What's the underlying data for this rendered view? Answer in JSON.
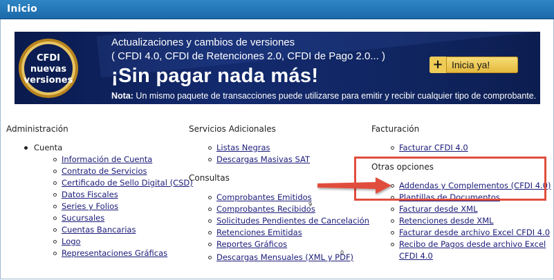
{
  "header": {
    "title": "Inicio"
  },
  "banner": {
    "badge_line1": "CFDI",
    "badge_line2": "nuevas",
    "badge_line3": "versiones",
    "line1": "Actualizaciones y cambios de versiones",
    "line2": "( CFDI 4.0, CFDI de Retenciones 2.0, CFDI de Pago 2.0... )",
    "headline": "¡Sin pagar nada más!",
    "note_bold": "Nota:",
    "note_text": " Un mismo paquete de transacciones puede utilizarse para emitir y recibir cualquier tipo de comprobante.",
    "cta_plus": "+",
    "cta_label": "Inicia ya!"
  },
  "administracion": {
    "title": "Administración",
    "group": "Cuenta",
    "items": [
      "Información de Cuenta",
      "Contrato de Servicios",
      "Certificado de Sello Digital (CSD)",
      "Datos Fiscales",
      "Series y Folios",
      "Sucursales",
      "Cuentas Bancarias",
      "Logo",
      "Representaciones Gráficas"
    ]
  },
  "servicios": {
    "title": "Servicios Adicionales",
    "items": [
      "Listas Negras",
      "Descargas Masivas SAT"
    ]
  },
  "consultas": {
    "title": "Consultas",
    "items": [
      {
        "label": "Comprobantes Emitidos",
        "count": ""
      },
      {
        "label": "Comprobantes Recibidos",
        "count": "9"
      },
      {
        "label": "Solicitudes Pendientes de Cancelación",
        "count": ""
      },
      {
        "label": "Retenciones Emitidas",
        "count": ""
      },
      {
        "label": "Reportes Gráficos",
        "count": ""
      },
      {
        "label": "Descargas Mensuales (XML y PDF)",
        "count": "0"
      }
    ]
  },
  "facturacion": {
    "title": "Facturación",
    "items": [
      "Facturar CFDI 4.0"
    ],
    "otras_title": "Otras opciones",
    "otras_items": [
      "Addendas y Complementos (CFDI 4.0)",
      "Plantillas de Documentos",
      "Facturar desde XML",
      "Retenciones desde XML",
      "Facturar desde archivo Excel CFDI 4.0",
      "Recibo de Pagos desde archivo Excel",
      "CFDI 4.0"
    ]
  },
  "colors": {
    "accent": "#1b69aa",
    "link": "#1a1a7a",
    "highlight": "#e14d3c",
    "cta": "#e4b83a"
  }
}
